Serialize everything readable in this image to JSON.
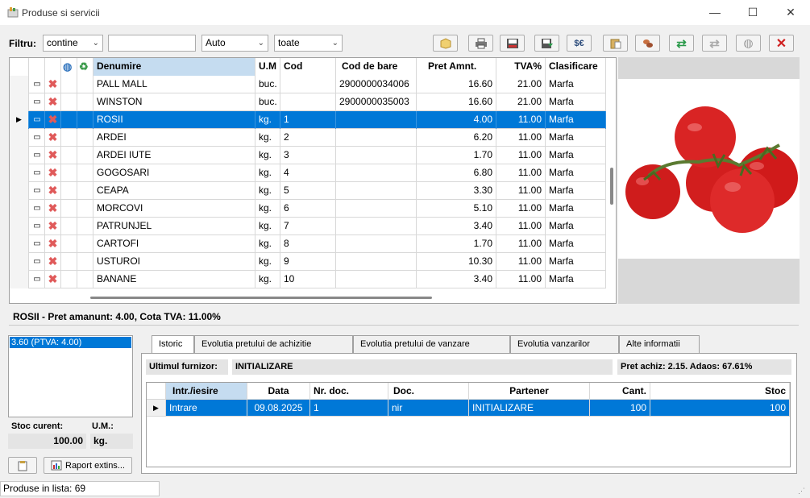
{
  "window": {
    "title": "Produse si servicii",
    "minimize": "—",
    "maximize": "☐",
    "close": "✕"
  },
  "filter": {
    "label": "Filtru:",
    "mode": "contine",
    "text": "",
    "type": "Auto",
    "scope": "toate"
  },
  "toolbar": {
    "icons": [
      "box-icon",
      "print-icon",
      "export-icon",
      "import-icon",
      "currency-icon",
      "paste-icon",
      "move-icon",
      "refresh-icon",
      "sync-icon",
      "web-icon",
      "delete-icon"
    ]
  },
  "grid": {
    "headers": {
      "name": "Denumire",
      "um": "U.M",
      "code": "Cod",
      "barcode": "Cod de bare",
      "price": "Pret Amnt.",
      "vat": "TVA%",
      "class": "Clasificare"
    },
    "rows": [
      {
        "name": "PALL MALL",
        "um": "buc.",
        "code": "",
        "barcode": "2900000034006",
        "price": "16.60",
        "vat": "21.00",
        "class": "Marfa"
      },
      {
        "name": "WINSTON",
        "um": "buc.",
        "code": "",
        "barcode": "2900000035003",
        "price": "16.60",
        "vat": "21.00",
        "class": "Marfa"
      },
      {
        "name": "ROSII",
        "um": "kg.",
        "code": "1",
        "barcode": "",
        "price": "4.00",
        "vat": "11.00",
        "class": "Marfa"
      },
      {
        "name": "ARDEI",
        "um": "kg.",
        "code": "2",
        "barcode": "",
        "price": "6.20",
        "vat": "11.00",
        "class": "Marfa"
      },
      {
        "name": "ARDEI IUTE",
        "um": "kg.",
        "code": "3",
        "barcode": "",
        "price": "1.70",
        "vat": "11.00",
        "class": "Marfa"
      },
      {
        "name": "GOGOSARI",
        "um": "kg.",
        "code": "4",
        "barcode": "",
        "price": "6.80",
        "vat": "11.00",
        "class": "Marfa"
      },
      {
        "name": "CEAPA",
        "um": "kg.",
        "code": "5",
        "barcode": "",
        "price": "3.30",
        "vat": "11.00",
        "class": "Marfa"
      },
      {
        "name": "MORCOVI",
        "um": "kg.",
        "code": "6",
        "barcode": "",
        "price": "5.10",
        "vat": "11.00",
        "class": "Marfa"
      },
      {
        "name": "PATRUNJEL",
        "um": "kg.",
        "code": "7",
        "barcode": "",
        "price": "3.40",
        "vat": "11.00",
        "class": "Marfa"
      },
      {
        "name": "CARTOFI",
        "um": "kg.",
        "code": "8",
        "barcode": "",
        "price": "1.70",
        "vat": "11.00",
        "class": "Marfa"
      },
      {
        "name": "USTUROI",
        "um": "kg.",
        "code": "9",
        "barcode": "",
        "price": "10.30",
        "vat": "11.00",
        "class": "Marfa"
      },
      {
        "name": "BANANE",
        "um": "kg.",
        "code": "10",
        "barcode": "",
        "price": "3.40",
        "vat": "11.00",
        "class": "Marfa"
      }
    ]
  },
  "summary": "ROSII - Pret amanunt: 4.00, Cota TVA: 11.00%",
  "prices": {
    "item": "3.60 (PTVA: 4.00)"
  },
  "stock": {
    "label": "Stoc curent:",
    "um_label": "U.M.:",
    "value": "100.00",
    "um": "kg."
  },
  "buttons": {
    "report": "Raport extins..."
  },
  "tabs": [
    "Istoric",
    "Evolutia pretului de achizitie",
    "Evolutia pretului de vanzare",
    "Evolutia vanzarilor",
    "Alte informatii"
  ],
  "supplier": {
    "label": "Ultimul furnizor:",
    "value": "INITIALIZARE",
    "margin": "Pret achiz: 2.15. Adaos: 67.61%"
  },
  "history": {
    "headers": {
      "type": "Intr./iesire",
      "date": "Data",
      "nr": "Nr. doc.",
      "doc": "Doc.",
      "partner": "Partener",
      "qty": "Cant.",
      "stock": "Stoc"
    },
    "rows": [
      {
        "type": "Intrare",
        "date": "09.08.2025",
        "nr": "1",
        "doc": "nir",
        "partner": "INITIALIZARE",
        "qty": "100",
        "stock": "100"
      }
    ]
  },
  "status": "Produse in lista: 69"
}
